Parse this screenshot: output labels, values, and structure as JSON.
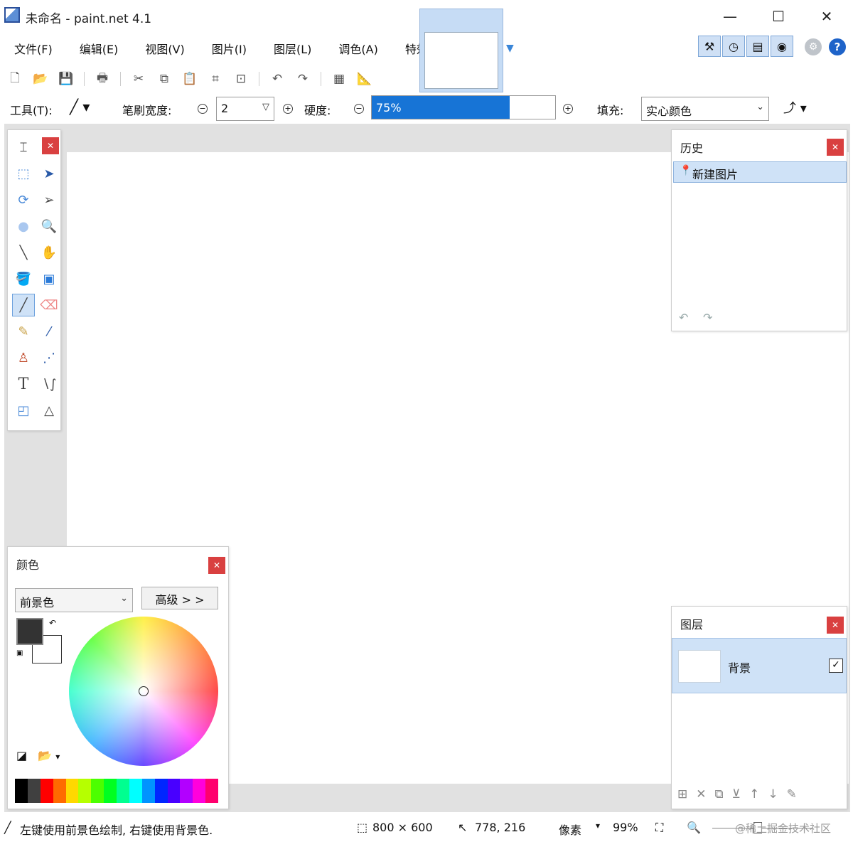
{
  "window": {
    "title": "未命名 - paint.net 4.1",
    "minimize": "—",
    "maximize": "☐",
    "close": "✕"
  },
  "menu": [
    "文件(F)",
    "编辑(E)",
    "视图(V)",
    "图片(I)",
    "图层(L)",
    "调色(A)",
    "特效(C)"
  ],
  "toolbar_icons": [
    "new-icon",
    "open-icon",
    "save-icon",
    "print-icon",
    "cut-icon",
    "copy-icon",
    "paste-icon",
    "crop-icon",
    "deselect-icon",
    "undo-icon",
    "redo-icon",
    "grid-icon",
    "ruler-icon"
  ],
  "tool_options": {
    "tool_label": "工具(T):",
    "brush_width_label": "笔刷宽度:",
    "brush_width_value": "2",
    "hardness_label": "硬度:",
    "hardness_value": "75%",
    "hardness_fraction": 0.75,
    "fill_label": "填充:",
    "fill_value": "实心颜色"
  },
  "top_right_buttons": [
    "tools-window-icon",
    "history-window-icon",
    "layers-window-icon",
    "colors-window-icon"
  ],
  "tools_panel": {
    "active_tool": "paintbrush",
    "tools": [
      "move-selection-icon",
      "move-selection-icon",
      "rectangle-select-icon",
      "move-selected-pixels-icon",
      "lasso-select-icon",
      "move-selection-arrow-icon",
      "ellipse-select-icon",
      "zoom-icon",
      "magic-wand-icon",
      "pan-icon",
      "paint-bucket-icon",
      "gradient-icon",
      "paintbrush-icon",
      "eraser-icon",
      "pencil-icon",
      "color-picker-icon",
      "clone-stamp-icon",
      "recolor-icon",
      "text-icon",
      "line-curve-icon",
      "shapes-icon"
    ]
  },
  "history_panel": {
    "title": "历史",
    "items": [
      "新建图片"
    ]
  },
  "colors_panel": {
    "title": "颜色",
    "mode": "前景色",
    "advanced_button": "高级 > >",
    "primary_color": "#333333",
    "secondary_color": "#ffffff",
    "palette": [
      "#000000",
      "#404040",
      "#ff0000",
      "#ff6a00",
      "#ffd800",
      "#b6ff00",
      "#4cff00",
      "#00ff21",
      "#00ff90",
      "#00ffff",
      "#0094ff",
      "#0026ff",
      "#4800ff",
      "#b200ff",
      "#ff00dc",
      "#ff006e"
    ]
  },
  "layers_panel": {
    "title": "图层",
    "layers": [
      {
        "name": "背景",
        "visible": true
      }
    ]
  },
  "status": {
    "hint": "左键使用前景色绘制, 右键使用背景色.",
    "image_size": "800 × 600",
    "cursor_pos": "778, 216",
    "units": "像素",
    "zoom": "99%",
    "watermark": "@稀土掘金技术社区"
  }
}
